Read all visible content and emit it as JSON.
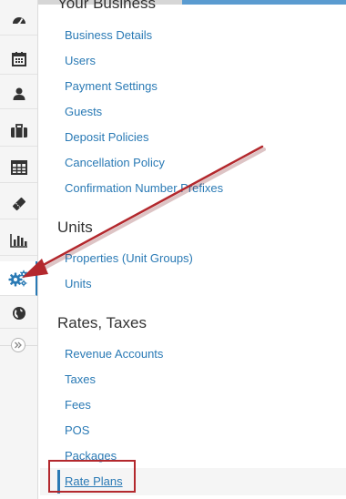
{
  "sections": [
    {
      "title": "Your Business",
      "items": [
        {
          "label": "Business Details"
        },
        {
          "label": "Users"
        },
        {
          "label": "Payment Settings"
        },
        {
          "label": "Guests"
        },
        {
          "label": "Deposit Policies"
        },
        {
          "label": "Cancellation Policy"
        },
        {
          "label": "Confirmation Number Prefixes"
        }
      ]
    },
    {
      "title": "Units",
      "items": [
        {
          "label": "Properties (Unit Groups)"
        },
        {
          "label": "Units"
        }
      ]
    },
    {
      "title": "Rates, Taxes",
      "items": [
        {
          "label": "Revenue Accounts"
        },
        {
          "label": "Taxes"
        },
        {
          "label": "Fees"
        },
        {
          "label": "POS"
        },
        {
          "label": "Packages"
        },
        {
          "label": "Rate Plans"
        }
      ]
    }
  ],
  "sidebar": {
    "icons": [
      {
        "icon": "dashboard-icon"
      },
      {
        "icon": "calendar-icon"
      },
      {
        "icon": "user-icon"
      },
      {
        "icon": "briefcase-icon"
      },
      {
        "icon": "table-icon"
      },
      {
        "icon": "ticket-icon"
      },
      {
        "icon": "bar-chart-icon"
      },
      {
        "icon": "gears-icon",
        "active": true
      },
      {
        "icon": "globe-icon"
      }
    ],
    "expand_icon": "double-chevron-right-icon"
  },
  "active_item": "Rate Plans",
  "colors": {
    "link": "#2a7ab5",
    "heading": "#333333",
    "annotation": "#b3282d",
    "sidebar_bg": "#f5f5f5"
  }
}
